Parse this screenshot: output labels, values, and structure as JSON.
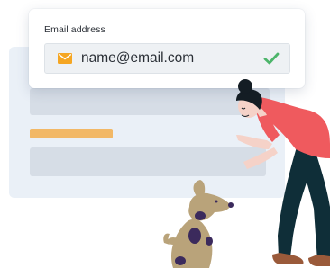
{
  "email_card": {
    "label": "Email address",
    "value": "name@email.com",
    "leading_icon": "mail-icon",
    "status_icon": "check-icon"
  },
  "colors": {
    "mail_icon": "#f5a623",
    "check": "#4cb56a",
    "person_shirt": "#ef5a5e",
    "person_pants": "#0f2e38",
    "dog": "#b9a37a",
    "dog_spots": "#3b2a5c",
    "accent_bar": "#f2b866"
  }
}
